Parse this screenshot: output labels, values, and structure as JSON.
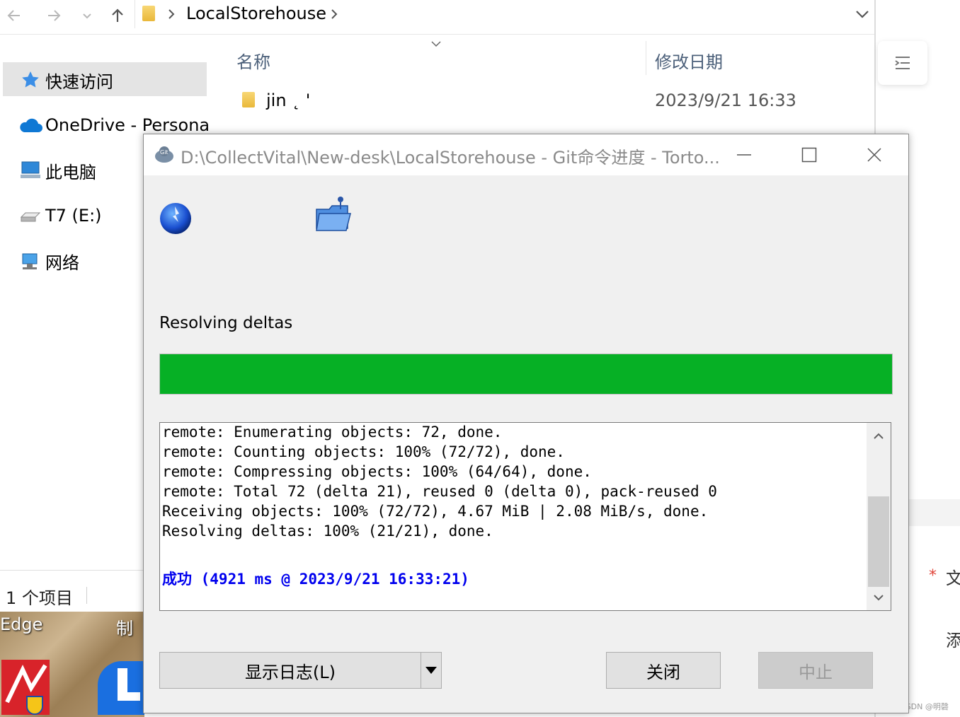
{
  "explorer": {
    "breadcrumb": {
      "folder": "LocalStorehouse"
    },
    "sidebar": {
      "items": [
        {
          "label": "快速访问",
          "icon": "star-icon"
        },
        {
          "label": "OneDrive - Persona",
          "icon": "cloud-icon"
        },
        {
          "label": "此电脑",
          "icon": "computer-icon"
        },
        {
          "label": "T7 (E:)",
          "icon": "drive-icon"
        },
        {
          "label": "网络",
          "icon": "network-icon"
        }
      ]
    },
    "columns": {
      "name": "名称",
      "modified": "修改日期"
    },
    "files": [
      {
        "name": "jin ˛ '",
        "modified": "2023/9/21 16:33"
      }
    ],
    "status": "1 个项目"
  },
  "desktop": {
    "labels": [
      "Edge",
      "制"
    ]
  },
  "dialog": {
    "title": "D:\\CollectVital\\New-desk\\LocalStorehouse - Git命令进度 - Torto...",
    "status_label": "Resolving deltas",
    "progress": 1.0,
    "progress_color": "#06b025",
    "log": {
      "lines": [
        "remote: Enumerating objects: 72, done.",
        "remote: Counting objects: 100% (72/72), done.",
        "remote: Compressing objects: 100% (64/64), done.",
        "remote: Total 72 (delta 21), reused 0 (delta 0), pack-reused 0",
        "Receiving objects: 100% (72/72), 4.67 MiB | 2.08 MiB/s, done.",
        "Resolving deltas: 100% (21/21), done."
      ],
      "success": "成功 (4921 ms @ 2023/9/21 16:33:21)"
    },
    "buttons": {
      "show_log": "显示日志(L)",
      "close": "关闭",
      "abort": "中止"
    }
  },
  "right_pane": {
    "text1": "文",
    "text2": "添",
    "star": "*",
    "watermark": "CSDN @明磬"
  }
}
